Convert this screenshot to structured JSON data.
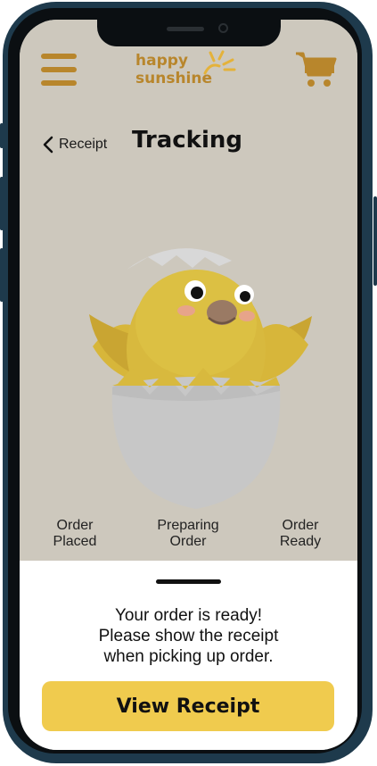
{
  "header": {
    "logo": {
      "line1": "happy",
      "line2": "sunshine"
    }
  },
  "nav": {
    "back_label": "Receipt",
    "title": "Tracking"
  },
  "steps": [
    {
      "line1": "Order",
      "line2": "Placed"
    },
    {
      "line1": "Preparing",
      "line2": "Order"
    },
    {
      "line1": "Order",
      "line2": "Ready"
    }
  ],
  "sheet": {
    "message": [
      "Your order is ready!",
      "Please show the receipt",
      "when picking up order."
    ],
    "button_label": "View Receipt"
  },
  "colors": {
    "brand": "#b8862c",
    "accent_button": "#f0cb4e",
    "overlay": "#cdc8bd",
    "frame": "#1e3a4c"
  },
  "icons": [
    "menu-icon",
    "cart-icon",
    "chevron-left-icon",
    "sun-icon",
    "chick-illustration"
  ]
}
